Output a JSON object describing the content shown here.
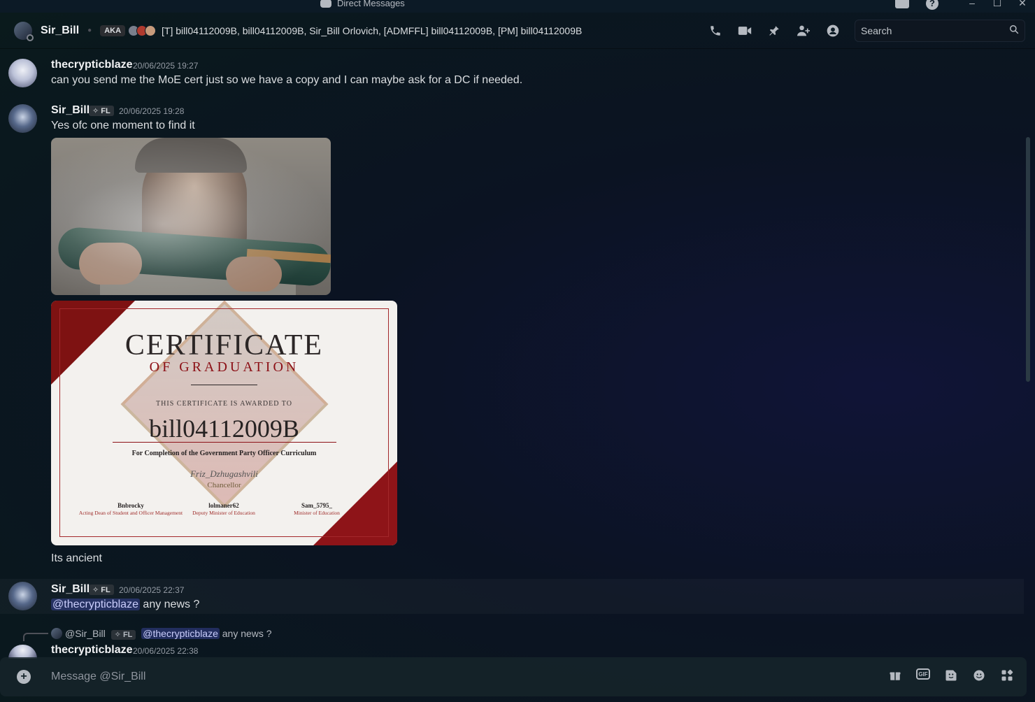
{
  "window": {
    "title": "Direct Messages",
    "controls": [
      "–",
      "☐",
      "✕"
    ]
  },
  "header": {
    "name": "Sir_Bill",
    "aka_label": "AKA",
    "aka_names": "[T] bill04112009B, bill04112009B, Sir_Bill Orlovich, [ADMFFL] bill04112009B, [PM] bill04112009B",
    "icons": [
      "phone-icon",
      "video-icon",
      "pin-icon",
      "add-friend-icon",
      "profile-icon"
    ],
    "search_placeholder": "Search"
  },
  "messages": [
    {
      "author": "thecrypticblaze",
      "timestamp": "20/06/2025 19:27",
      "text": "can you send me the MoE cert just so we have a copy and I can maybe ask for a DC if needed."
    },
    {
      "author": "Sir_Bill",
      "tag": "✧ FL",
      "timestamp": "20/06/2025 19:28",
      "text": "Yes ofc one moment to find it",
      "followup_text": "Its ancient"
    },
    {
      "author": "Sir_Bill",
      "tag": "✧ FL",
      "timestamp": "20/06/2025 22:37",
      "mention": "@thecrypticblaze",
      "text": " any news ?"
    },
    {
      "author": "thecrypticblaze",
      "timestamp": "20/06/2025 22:38",
      "reply": {
        "author": "@Sir_Bill",
        "tag": "✧ FL",
        "mention": "@thecrypticblaze",
        "text": " any news ?"
      }
    }
  ],
  "certificate": {
    "title": "CERTIFICATE",
    "subtitle": "OF GRADUATION",
    "awarded": "THIS CERTIFICATE IS AWARDED TO",
    "recipient": "bill04112009B",
    "purpose": "For Completion of the Government Party Officer Curriculum",
    "signature": "Friz_Dzhugashvili",
    "signature_role": "Chancellor",
    "signers": [
      {
        "name": "Bnbrocky",
        "role": "Acting Dean of Student and Officer Management"
      },
      {
        "name": "lolmaner62",
        "role": "Deputy Minister of Education"
      },
      {
        "name": "Sam_5795_",
        "role": "Minister of Education"
      }
    ]
  },
  "composer": {
    "placeholder": "Message @Sir_Bill",
    "icons": [
      "gift-icon",
      "gif-icon",
      "sticker-icon",
      "emoji-icon",
      "apps-icon"
    ],
    "gif_label": "GIF"
  }
}
